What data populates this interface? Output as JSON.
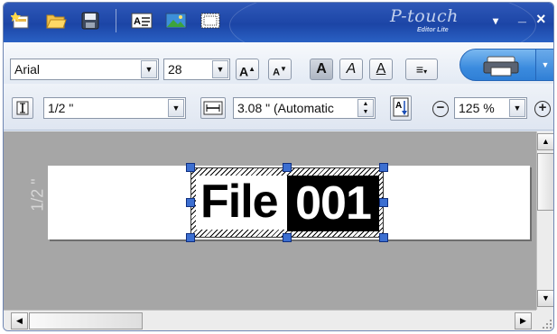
{
  "title_bar": {
    "brand": "P-touch",
    "brand_sub": "Editor Lite",
    "minimize": "_",
    "close": "×",
    "menu": "▾"
  },
  "toolbar1": {
    "font_name": "Arial",
    "font_size": "28",
    "font_size_up": "A",
    "font_size_down": "A",
    "bold": "A",
    "italic": "A",
    "underline": "A",
    "align_symbol": "≡"
  },
  "toolbar2": {
    "tape_width": "1/2 \"",
    "label_length": "3.08 \" (Automatic",
    "zoom": "125 %",
    "zoom_out": "−",
    "zoom_in": "+"
  },
  "canvas": {
    "ruler_label": "1/2 \"",
    "text_plain": "File ",
    "text_highlighted": "001"
  },
  "colors": {
    "title_bar": "#1c45a6",
    "handle": "#3c6fd1",
    "canvas_bg": "#a6a6a6"
  }
}
